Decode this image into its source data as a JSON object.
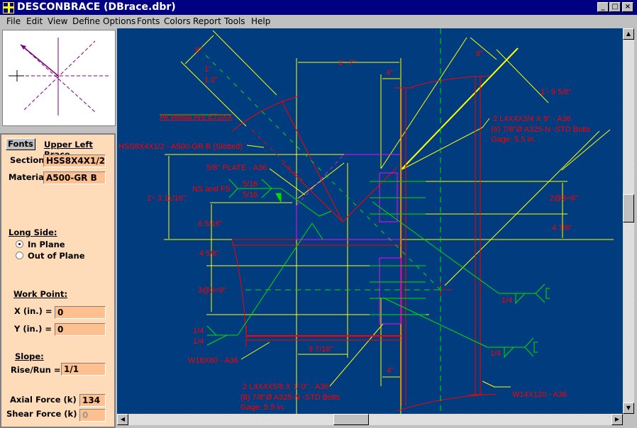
{
  "window": {
    "title": "DESCONBRACE (DBrace.dbr)",
    "controls": [
      "_",
      "□",
      "×"
    ]
  },
  "menu": [
    "File",
    "Edit",
    "View",
    "Define",
    "Options",
    "Fonts",
    "Colors",
    "Report",
    "Tools",
    "Help"
  ],
  "panel": {
    "fonts_button": "Fonts",
    "heading": "Upper Left Brace",
    "section_label": "Section:",
    "section_value": "HSS8X4X1/2",
    "material_label": "Material:",
    "material_value": "A500-GR B",
    "long_side_label": "Long Side:",
    "in_plane": "In Plane",
    "out_of_plane": "Out of Plane",
    "long_side_selected": "In Plane",
    "work_point_label": "Work Point:",
    "x_label": "X (in.) =",
    "x_value": "0",
    "y_label": "Y (in.) =",
    "y_value": "0",
    "slope_label": "Slope:",
    "rise_run_label": "Rise/Run =",
    "rise_run_value": "1/1",
    "axial_label": "Axial Force (k) :",
    "axial_value": "134",
    "shear_label": "Shear Force (k) :",
    "shear_value": "0"
  },
  "drawing": {
    "colors": {
      "background": "#003c7e",
      "dimension": "#ffff00",
      "member": "#ff0000",
      "weld": "#00e000",
      "plate": "#ff00ff"
    },
    "dim_8_brace": "8\"",
    "slope_1": "1\"",
    "slope_10": "1.0\"",
    "dim_1_7": "1'- 7\"",
    "dim_4_top": "4\"",
    "dim_8_angle": "8\"",
    "dim_1_9_5_8": "1'- 9  5/8\"",
    "all_welds": "All Welds Are E70XX",
    "hss_label": "HSS8X4X1/2 - A500-GR B (Slotted)",
    "plate_label": "5/8\" PLATE - A36",
    "weld_ns_fs": "NS and FS",
    "weld_516_top": "5/16",
    "weld_516_bot": "5/16",
    "dim_1_3_11_16": "1'- 3  11/16\"",
    "dim_6_5_16": "6  5/16\"",
    "dim_4_5_8": "4  5/8\"",
    "dim_3at3": "3@3=9\"",
    "upper_angles": [
      "2 L4X4X3/4 X 9\" - A36",
      "(6) 7/8\"Ø A325-N -STD  Bolts",
      "Gage: 5.5 in."
    ],
    "dim_2at3": "2@3=6\"",
    "dim_4_7_8": "4  7/8\"",
    "weld_14_a": "1/4",
    "weld_14_b": "1/4",
    "weld_14_left_top": "1/4",
    "weld_14_left_bot": "1/4",
    "beam_label": "W18X60 - A36",
    "dim_9_7_16": "9  7/16\"",
    "dim_4_bot": "4\"",
    "lower_angles": [
      "2 L4X4X5/8 X 1'-0\" - A36",
      "(8) 7/8\"Ø A325-N -STD  Bolts",
      "Gage: 5.5 in."
    ],
    "column_label": "W14X120 - A36"
  }
}
